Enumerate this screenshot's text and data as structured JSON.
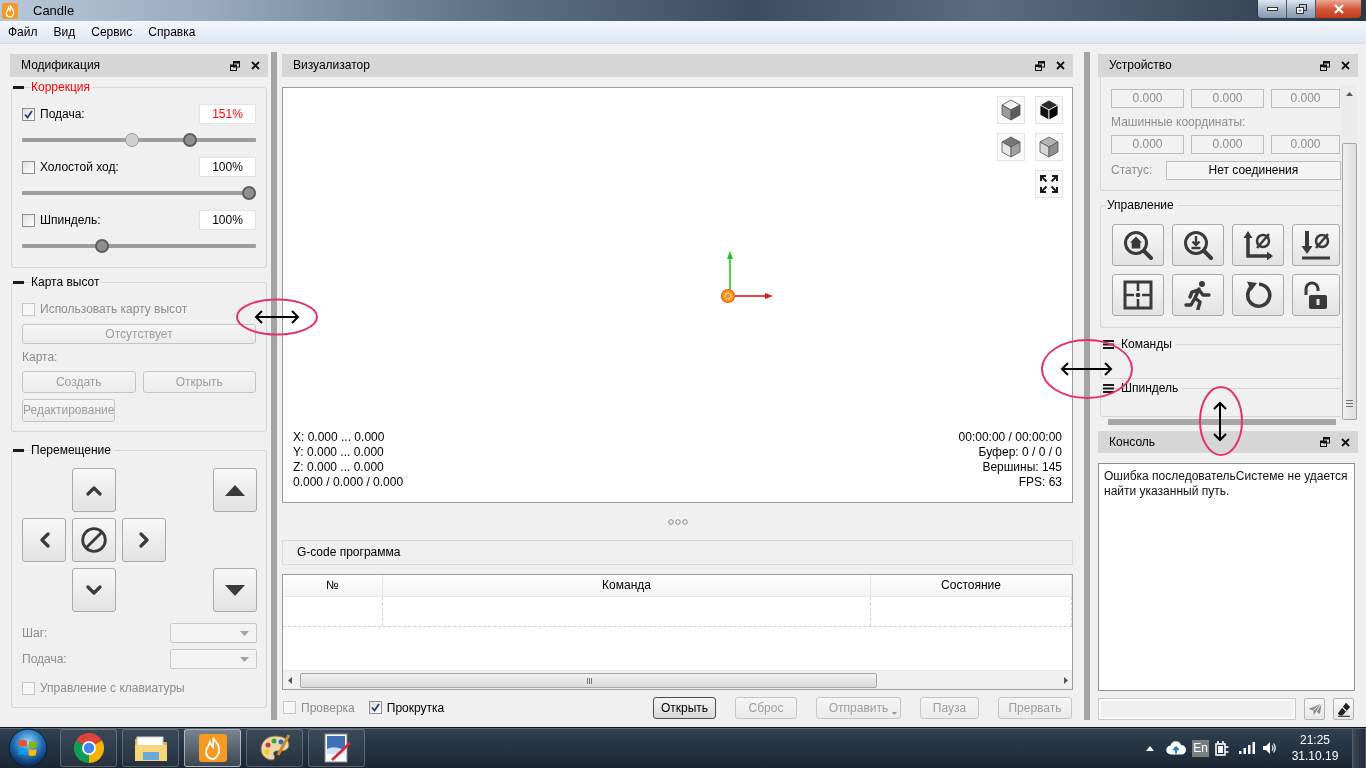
{
  "window": {
    "title": "Candle"
  },
  "menu": [
    {
      "label": "Файл"
    },
    {
      "label": "Вид"
    },
    {
      "label": "Сервис"
    },
    {
      "label": "Справка"
    }
  ],
  "modification": {
    "title": "Модификация",
    "correction": {
      "title": "Коррекция",
      "expanded": true,
      "highlighted": true,
      "rows": [
        {
          "label": "Подача:",
          "checked": true,
          "value": "151%",
          "overridden": true,
          "handles": [
            {
              "kind": "reference",
              "level": 0.47
            },
            {
              "kind": "current",
              "level": 0.73
            }
          ]
        },
        {
          "label": "Холостой ход:",
          "checked": false,
          "value": "100%",
          "overridden": false,
          "handles": [
            {
              "kind": "current",
              "level": 1
            }
          ]
        },
        {
          "label": "Шпиндель:",
          "checked": false,
          "value": "100%",
          "overridden": false,
          "handles": [
            {
              "kind": "current",
              "level": 0.33
            }
          ]
        }
      ]
    },
    "heightmap": {
      "title": "Карта высот",
      "expanded": true,
      "highlighted": false,
      "disabled": true,
      "use": {
        "label": "Использовать карту высот",
        "checked": false
      },
      "status": "Отсутствует",
      "map_label": "Карта:",
      "buttons": [
        {
          "label": "Создать"
        },
        {
          "label": "Открыть"
        },
        {
          "label": "Редактирование"
        }
      ]
    },
    "jog": {
      "title": "Перемещение",
      "expanded": true,
      "highlighted": false,
      "fields": [
        {
          "label": "Шаг:",
          "disabled": true
        },
        {
          "label": "Подача:",
          "disabled": true
        }
      ],
      "keyboard": {
        "label": "Управление с клавиатуры",
        "checked": false,
        "disabled": true
      }
    }
  },
  "visualizer": {
    "title": "Визуализатор",
    "info_left": [
      "X: 0.000 ... 0.000",
      "Y: 0.000 ... 0.000",
      "Z: 0.000 ... 0.000",
      "0.000 / 0.000 / 0.000"
    ],
    "info_right": [
      "00:00:00 / 00:00:00",
      "Буфер: 0 / 0 / 0",
      "Вершины: 145",
      "FPS: 63"
    ]
  },
  "program": {
    "title": "G-code программа",
    "columns": [
      "№",
      "Команда",
      "Состояние"
    ],
    "options": [
      {
        "label": "Проверка",
        "checked": false,
        "disabled": true
      },
      {
        "label": "Прокрутка",
        "checked": true,
        "disabled": false
      }
    ],
    "buttons": [
      {
        "label": "Открыть",
        "kind": "plain",
        "disabled": false,
        "default": true
      },
      {
        "label": "Сброс",
        "kind": "plain",
        "disabled": true,
        "default": false
      },
      {
        "label": "Отправить",
        "kind": "menu",
        "disabled": true,
        "default": false
      },
      {
        "label": "Пауза",
        "kind": "plain",
        "disabled": true,
        "default": false
      },
      {
        "label": "Прервать",
        "kind": "plain",
        "disabled": true,
        "default": false
      }
    ]
  },
  "device": {
    "title": "Устройство",
    "work_coords": {
      "values": [
        "0.000",
        "0.000",
        "0.000"
      ],
      "disabled": true
    },
    "machine_coords": {
      "label": "Машинные координаты:",
      "values": [
        "0.000",
        "0.000",
        "0.000"
      ],
      "disabled": true
    },
    "status": {
      "label": "Статус:",
      "value": "Нет соединения",
      "disabled": true
    },
    "control": {
      "title": "Управление"
    },
    "sections": [
      {
        "title": "Команды",
        "expanded": false
      },
      {
        "title": "Шпиндель",
        "expanded": false
      }
    ]
  },
  "console": {
    "title": "Консоль",
    "text": "Ошибка последовательСистеме не удается найти указанный путь."
  },
  "taskbar": {
    "apps": [
      {
        "kind": "browser",
        "selected": false
      },
      {
        "kind": "folder",
        "selected": false
      },
      {
        "kind": "flame",
        "selected": true
      },
      {
        "kind": "palette",
        "selected": false
      },
      {
        "kind": "picture",
        "selected": false
      }
    ],
    "language": "En",
    "time": "21:25",
    "date": "31.10.19"
  }
}
